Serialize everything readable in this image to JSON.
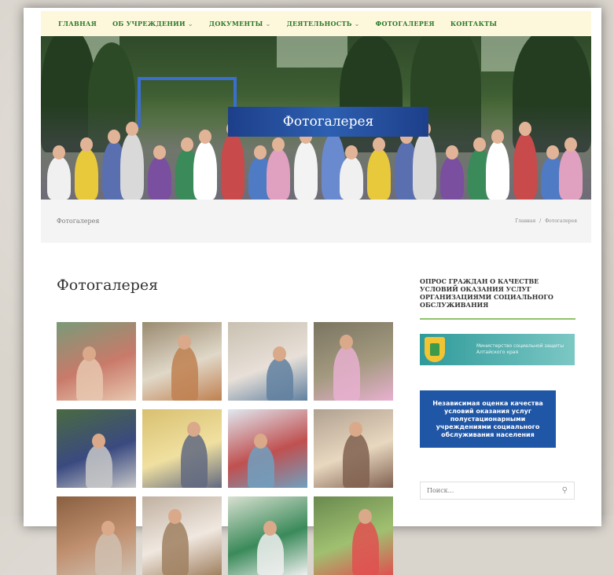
{
  "nav": {
    "items": [
      {
        "label": "ГЛАВНАЯ",
        "dropdown": false
      },
      {
        "label": "ОБ УЧРЕЖДЕНИИ",
        "dropdown": true
      },
      {
        "label": "ДОКУМЕНТЫ",
        "dropdown": true
      },
      {
        "label": "ДЕЯТЕЛЬНОСТЬ",
        "dropdown": true
      },
      {
        "label": "ФОТОГАЛЕРЕЯ",
        "dropdown": false
      },
      {
        "label": "КОНТАКТЫ",
        "dropdown": false
      }
    ],
    "caret": "⌄",
    "color": "#2a7a2a",
    "background": "#fdf7dc"
  },
  "hero": {
    "banner_text": "Фотогалерея",
    "banner_color": "#1d3f8a"
  },
  "breadcrumb": {
    "page_title": "Фотогалерея",
    "home": "Главная",
    "separator": "/",
    "current": "Фотогалерея"
  },
  "content": {
    "title": "Фотогалерея",
    "gallery_tiles": [
      {
        "name": "photo-woman-in-dress"
      },
      {
        "name": "photo-table-with-food"
      },
      {
        "name": "photo-office-consultation"
      },
      {
        "name": "photo-children-outdoors"
      },
      {
        "name": "photo-police-officer-crowd"
      },
      {
        "name": "photo-corridor-staff"
      },
      {
        "name": "photo-child-with-nurse"
      },
      {
        "name": "photo-baking-dough"
      },
      {
        "name": "photo-gallery-9"
      },
      {
        "name": "photo-gallery-10"
      },
      {
        "name": "photo-gallery-11"
      },
      {
        "name": "photo-gallery-12"
      }
    ]
  },
  "sidebar": {
    "survey_heading": "Опрос граждан о качестве условий оказания услуг организациями социального обслуживания",
    "ministry_text": "Министерство социальной защиты Алтайского края",
    "independent_assessment": "Независимая оценка качества условий оказания услуг полустационарными учреждениями социального обслуживания населения",
    "accent_color": "#8fc46a",
    "assessment_color": "#1f56a6"
  },
  "search": {
    "placeholder": "Поиск..."
  }
}
